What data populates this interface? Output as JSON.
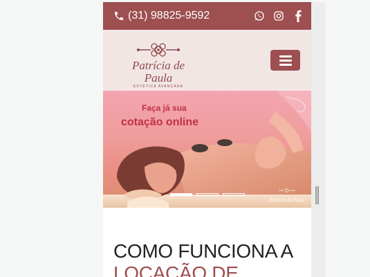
{
  "topbar": {
    "phone": "(31) 98825-9592",
    "phone_icon": "phone-icon",
    "social_icons": [
      "whatsapp-icon",
      "instagram-icon",
      "facebook-icon"
    ]
  },
  "logo": {
    "name": "Patrícia de Paula",
    "tagline": "ESTÉTICA AVANÇADA"
  },
  "menu": {
    "icon": "hamburger-menu-icon"
  },
  "hero": {
    "line1": "Faça já sua",
    "line2": "cotação online",
    "slides": 3,
    "active_slide": 1,
    "mini_logo": "Patrícia de Paula"
  },
  "content": {
    "heading_line1": "COMO FUNCIONA A",
    "heading_line2": "LOCAÇÃO DE"
  },
  "colors": {
    "brand": "#9e4f50",
    "header_bg": "#f2e6e5",
    "hero_text": "#c12f49"
  }
}
